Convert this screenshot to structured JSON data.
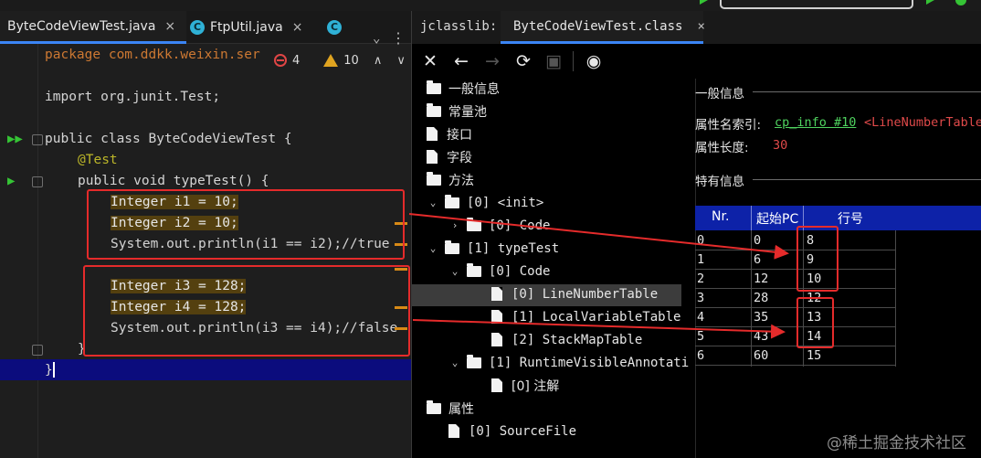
{
  "editor": {
    "tabs": [
      {
        "label": "ByteCodeViewTest.java",
        "close": "×"
      },
      {
        "label": "FtpUtil.java",
        "close": "×"
      },
      {
        "label": "",
        "close": ""
      }
    ],
    "icon_letter": "C",
    "inspections": {
      "errors": "4",
      "warnings": "10"
    },
    "lines": [
      "package com.ddkk.weixin.ser",
      "import org.junit.Test;",
      "public class ByteCodeViewTest {",
      "@Test",
      "public void typeTest() {",
      "Integer i1 = 10;",
      "Integer i2 = 10;",
      "System.out.println(i1 == i2);//true",
      "Integer i3 = 128;",
      "Integer i4 = 128;",
      "System.out.println(i3 == i4);//false",
      "}",
      "}"
    ]
  },
  "jclasslib": {
    "label": "jclasslib:",
    "tab": "ByteCodeViewTest.class",
    "toolbar": [
      "close",
      "back",
      "forward",
      "refresh",
      "save",
      "web"
    ],
    "tree": [
      {
        "text": "一般信息"
      },
      {
        "text": "常量池"
      },
      {
        "text": "接口"
      },
      {
        "text": "字段"
      },
      {
        "text": "方法"
      },
      {
        "text": "[0] <init>"
      },
      {
        "text": "[0] Code"
      },
      {
        "text": "[1] typeTest"
      },
      {
        "text": "[0] Code"
      },
      {
        "text": "[0] LineNumberTable"
      },
      {
        "text": "[1] LocalVariableTable"
      },
      {
        "text": "[2] StackMapTable"
      },
      {
        "text": "[1] RuntimeVisibleAnnotati"
      },
      {
        "text": "[0] 注解"
      },
      {
        "text": "属性"
      },
      {
        "text": "[0] SourceFile"
      }
    ],
    "details": {
      "section_general": "一般信息",
      "attr_name_label": "属性名索引:",
      "attr_name_link": "cp_info #10",
      "attr_name_value": "<LineNumberTable",
      "attr_length_label": "属性长度:",
      "attr_length_value": "30",
      "section_specific": "特有信息"
    },
    "table": {
      "headers": [
        "Nr.",
        "起始PC",
        "行号"
      ],
      "rows": [
        [
          "0",
          "0",
          "8"
        ],
        [
          "1",
          "6",
          "9"
        ],
        [
          "2",
          "12",
          "10"
        ],
        [
          "3",
          "28",
          "12"
        ],
        [
          "4",
          "35",
          "13"
        ],
        [
          "5",
          "43",
          "14"
        ],
        [
          "6",
          "60",
          "15"
        ]
      ]
    }
  },
  "watermark": "@稀土掘金技术社区",
  "colors": {
    "annotation_red": "#e52b2b",
    "header_blue": "#0d22a8",
    "current_line": "#0b0c7d"
  }
}
